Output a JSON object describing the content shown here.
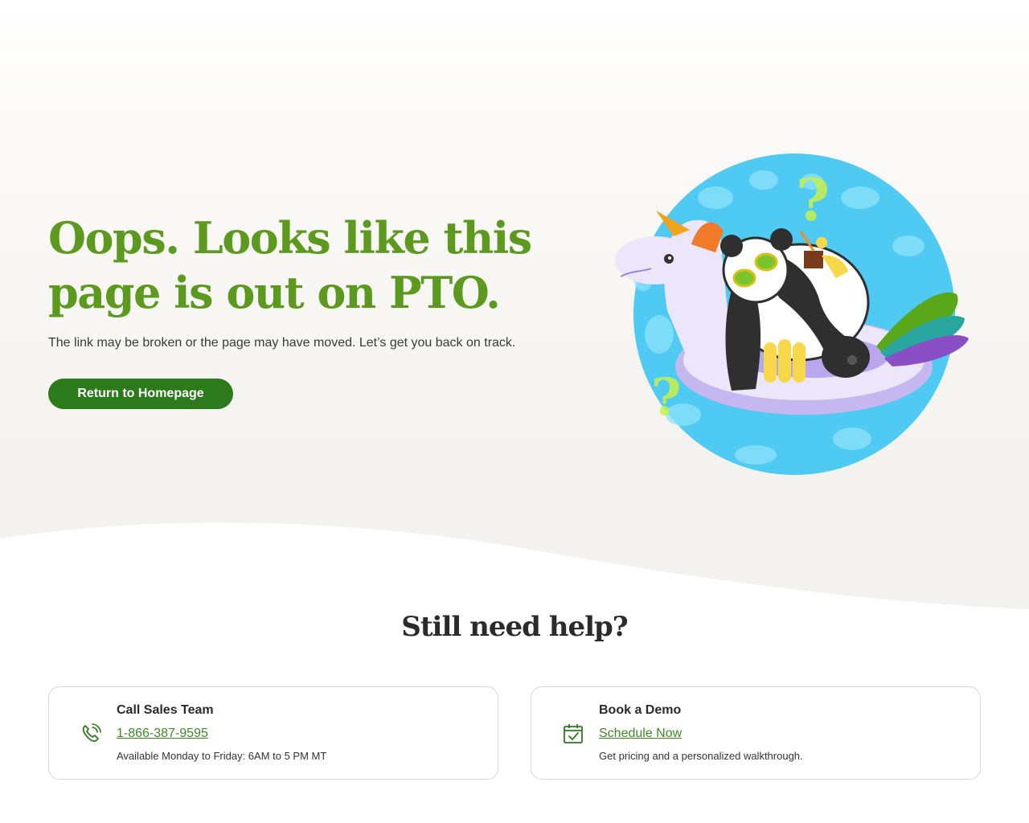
{
  "hero": {
    "title": "Oops. Looks like this page is out on PTO.",
    "subtitle": "The link may be broken or the page may have moved. Let’s get you back on track.",
    "button_label": "Return to Homepage"
  },
  "help": {
    "heading": "Still need help?",
    "cards": [
      {
        "icon": "phone-icon",
        "title": "Call Sales Team",
        "link_text": "1-866-387-9595",
        "note": "Available Monday to Friday: 6AM to 5 PM MT"
      },
      {
        "icon": "calendar-icon",
        "title": "Book a Demo",
        "link_text": "Schedule Now",
        "note": "Get pricing and a personalized walkthrough."
      }
    ]
  },
  "colors": {
    "brand_green": "#5b9a1f",
    "button_green": "#2d7a1d",
    "link_green": "#3d8a23",
    "pool_blue": "#4fcaf3"
  }
}
